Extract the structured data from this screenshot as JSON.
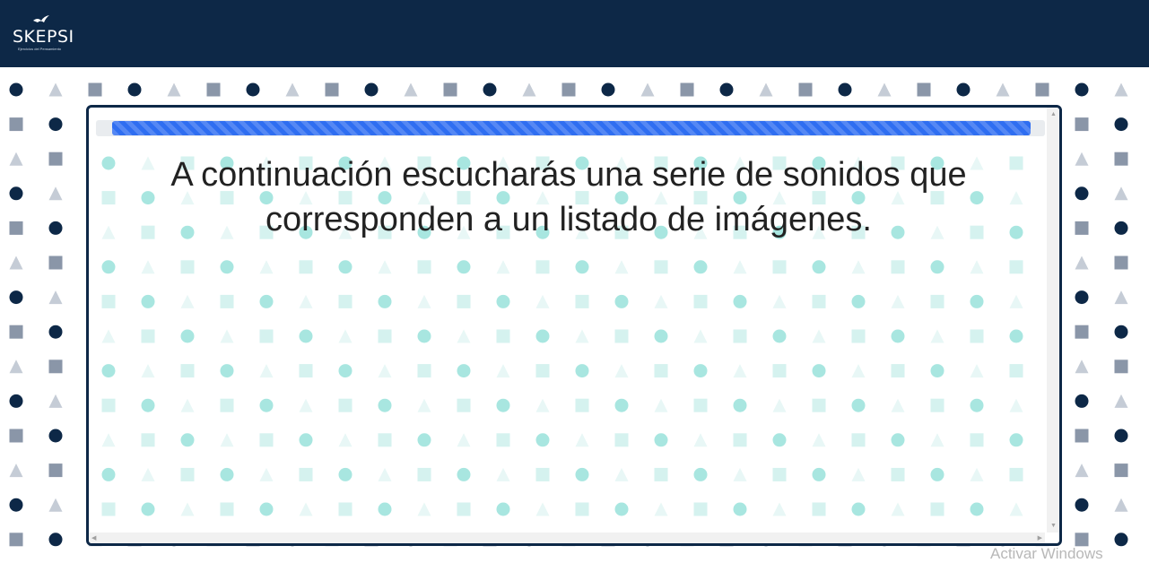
{
  "brand": {
    "name": "SKEPSI",
    "tagline": "Ejercicios del Pensamiento"
  },
  "colors": {
    "header": "#0d2847",
    "panel_border": "#0d2847",
    "progress": "#2f6ef1",
    "pattern_dark": "#0d2847",
    "pattern_gray": "#8a96a8",
    "pattern_teal": "#a8e6e0"
  },
  "progress": {
    "percent": 100
  },
  "instruction": {
    "text": "A continuación escucharás una serie de sonidos que corresponden a un listado de imágenes."
  },
  "os_overlay": {
    "watermark": "Activar Windows"
  }
}
